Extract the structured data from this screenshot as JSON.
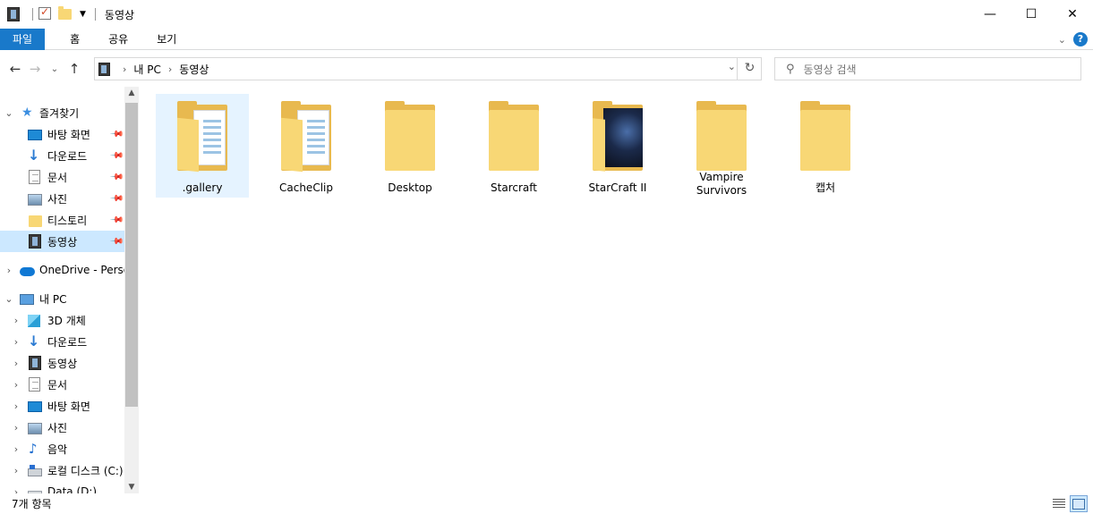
{
  "window": {
    "title": "동영상",
    "controls": {
      "minimize": "—",
      "maximize": "☐",
      "close": "✕"
    }
  },
  "ribbon": {
    "tabs": [
      "파일",
      "홈",
      "공유",
      "보기"
    ]
  },
  "nav": {
    "back": "←",
    "forward": "→",
    "recent": "⌄",
    "up": "↑",
    "breadcrumb": [
      "내 PC",
      "동영상"
    ],
    "search_placeholder": "동영상 검색"
  },
  "sidebar": {
    "quick_access": {
      "label": "즐겨찾기",
      "items": [
        {
          "label": "바탕 화면",
          "icon": "desktop-icon",
          "pinned": true
        },
        {
          "label": "다운로드",
          "icon": "download-icon",
          "pinned": true
        },
        {
          "label": "문서",
          "icon": "document-icon",
          "pinned": true
        },
        {
          "label": "사진",
          "icon": "picture-icon",
          "pinned": true
        },
        {
          "label": "티스토리",
          "icon": "folder-icon",
          "pinned": true
        },
        {
          "label": "동영상",
          "icon": "video-icon",
          "pinned": true,
          "selected": true
        }
      ]
    },
    "onedrive": {
      "label": "OneDrive - Person"
    },
    "this_pc": {
      "label": "내 PC",
      "items": [
        {
          "label": "3D 개체",
          "icon": "3d-objects-icon"
        },
        {
          "label": "다운로드",
          "icon": "download-icon"
        },
        {
          "label": "동영상",
          "icon": "video-icon"
        },
        {
          "label": "문서",
          "icon": "document-icon"
        },
        {
          "label": "바탕 화면",
          "icon": "desktop-icon"
        },
        {
          "label": "사진",
          "icon": "picture-icon"
        },
        {
          "label": "음악",
          "icon": "music-icon"
        },
        {
          "label": "로컬 디스크 (C:)",
          "icon": "local-disk-icon"
        },
        {
          "label": "Data (D:)",
          "icon": "drive-icon"
        }
      ]
    }
  },
  "content": {
    "items": [
      {
        "label": ".gallery",
        "type": "folder-with-docs",
        "selected": true
      },
      {
        "label": "CacheClip",
        "type": "folder-with-docs"
      },
      {
        "label": "Desktop",
        "type": "folder"
      },
      {
        "label": "Starcraft",
        "type": "folder"
      },
      {
        "label": "StarCraft II",
        "type": "folder-with-image"
      },
      {
        "label": "Vampire Survivors",
        "type": "folder"
      },
      {
        "label": "캡처",
        "type": "folder"
      }
    ]
  },
  "status": {
    "item_count": "7개 항목"
  }
}
